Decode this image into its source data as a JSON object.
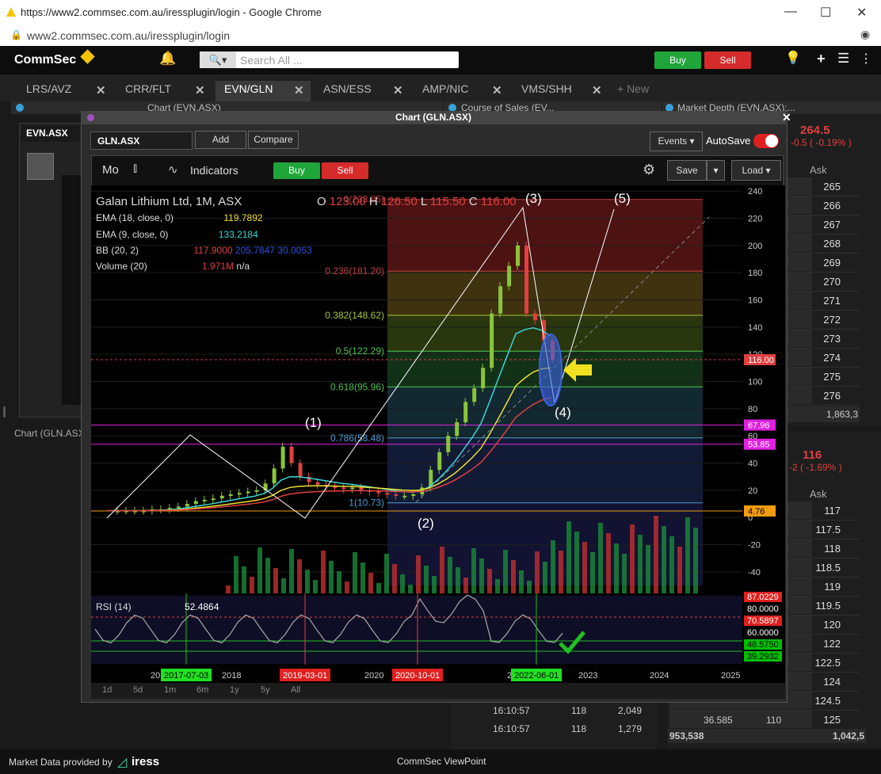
{
  "browser": {
    "title": "https://www2.commsec.com.au/iressplugin/login - Google Chrome",
    "url": "www2.commsec.com.au/iressplugin/login"
  },
  "app": {
    "logo": "CommSec",
    "search_placeholder": "Search All ...",
    "buy_label": "Buy",
    "sell_label": "Sell"
  },
  "tabs": [
    {
      "label": "LRS/AVZ"
    },
    {
      "label": "CRR/FLT"
    },
    {
      "label": "EVN/GLN"
    },
    {
      "label": "ASN/ESS"
    },
    {
      "label": "AMP/NIC"
    },
    {
      "label": "VMS/SHH"
    },
    {
      "label": "+ New"
    }
  ],
  "panels": {
    "chart_evn": "Chart (EVN.ASX)",
    "course_of_sales": "Course of Sales (EV...",
    "market_depth": "Market Depth (EVN.ASX):...",
    "left_symbol": "EVN.ASX",
    "left_footer": "Chart (GLN.ASX)"
  },
  "depth_top": {
    "price": "264.5",
    "change": "-0.5 ( -0.19% )",
    "ask_header": "Ask",
    "asks": [
      "265",
      "266",
      "267",
      "268",
      "269",
      "270",
      "271",
      "272",
      "273",
      "274",
      "275",
      "276"
    ],
    "footer_value": "1,863,3"
  },
  "depth_bottom": {
    "price": "116",
    "change": "-2 ( -1.69% )",
    "ask_header": "Ask",
    "asks": [
      "117",
      "117.5",
      "118",
      "118.5",
      "119",
      "119.5",
      "120",
      "122",
      "122.5",
      "124",
      "124.5",
      "125"
    ],
    "last_row": [
      "36.585",
      "110"
    ],
    "footer_left": "953,538",
    "footer_right": "1,042,5"
  },
  "cos_rows": [
    [
      "16:10:57",
      "118",
      "2,049"
    ],
    [
      "16:10:57",
      "118",
      "1,279"
    ]
  ],
  "modal": {
    "title": "Chart (GLN.ASX)",
    "symbol": "GLN.ASX",
    "add_label": "Add",
    "compare_label": "Compare",
    "events_label": "Events",
    "autosave_label": "AutoSave",
    "period_label": "Mo",
    "indicators_label": "Indicators",
    "buy_label": "Buy",
    "sell_label": "Sell",
    "save_label": "Save",
    "load_label": "Load",
    "timeframes": [
      "1d",
      "5d",
      "1m",
      "6m",
      "1y",
      "5y",
      "All"
    ]
  },
  "legend": {
    "title": "Galan Lithium Ltd, 1M, ASX",
    "ohlc": {
      "o": "123.00",
      "h": "126.50",
      "l": "115.50",
      "c": "116.00"
    },
    "ema18": {
      "label": "EMA (18, close, 0)",
      "value": "119.7892"
    },
    "ema9": {
      "label": "EMA (9, close, 0)",
      "value": "133.2184"
    },
    "bb": {
      "label": "BB (20, 2)",
      "v1": "117.9000",
      "v2": "205.7847",
      "v3": "30.0053"
    },
    "volume": {
      "label": "Volume (20)",
      "v1": "1.971M",
      "v2": "n/a"
    },
    "rsi": {
      "label": "RSI (14)",
      "value": "52.4864"
    }
  },
  "chart_data": {
    "type": "line",
    "title": "Galan Lithium Ltd, 1M, ASX",
    "y_ticks": [
      240,
      220,
      200,
      180,
      160,
      140,
      120,
      100,
      80,
      60,
      40,
      20,
      0,
      -20,
      -40
    ],
    "ylim": [
      -50,
      250
    ],
    "x_ticks": [
      "2017",
      "2018",
      "2019",
      "2020",
      "2021",
      "2022",
      "2023",
      "2024",
      "2025"
    ],
    "date_flags": [
      "2017-07-03",
      "2019-03-01",
      "2020-10-01",
      "2022-06-01"
    ],
    "fib_levels": [
      {
        "label": "0(233.85)",
        "value": 233.85,
        "color": "#c04040"
      },
      {
        "label": "0.236(181.20)",
        "value": 181.2,
        "color": "#c04040"
      },
      {
        "label": "0.382(148.62)",
        "value": 148.62,
        "color": "#a6c43a"
      },
      {
        "label": "0.5(122.29)",
        "value": 122.29,
        "color": "#4fc44f"
      },
      {
        "label": "0.618(95.96)",
        "value": 95.96,
        "color": "#4fc44f"
      },
      {
        "label": "0.786(58.48)",
        "value": 58.48,
        "color": "#4a9ad4"
      },
      {
        "label": "1(10.73)",
        "value": 10.73,
        "color": "#4a9ad4"
      }
    ],
    "price_tags": [
      {
        "label": "116.00",
        "value": 116.0,
        "color": "#e04040"
      },
      {
        "label": "67.96",
        "value": 67.96,
        "color": "#e020e0"
      },
      {
        "label": "53.85",
        "value": 53.85,
        "color": "#e020e0"
      },
      {
        "label": "4.76",
        "value": 4.76,
        "color": "#f39c12"
      }
    ],
    "wave_labels": [
      "(1)",
      "(2)",
      "(3)",
      "(4)",
      "(5)"
    ],
    "rsi_tags": [
      {
        "label": "87.0229",
        "color": "#e02020"
      },
      {
        "label": "80.0000",
        "color": "#000000"
      },
      {
        "label": "70.5897",
        "color": "#e02020"
      },
      {
        "label": "60.0000",
        "color": "#000000"
      },
      {
        "label": "48.5750",
        "color": "#00c000"
      },
      {
        "label": "39.2932",
        "color": "#00c000"
      }
    ],
    "series": [
      {
        "values": [
          5,
          5,
          5,
          5,
          5,
          6,
          6,
          7,
          8,
          10,
          12,
          13,
          14,
          16,
          17,
          18,
          19,
          20,
          25,
          36,
          52,
          40,
          30,
          26,
          24,
          23,
          22,
          21,
          22,
          20,
          19,
          18,
          17,
          16,
          16,
          17,
          22,
          35,
          48,
          60,
          70,
          85,
          95,
          110,
          150,
          170,
          185,
          200,
          150,
          145,
          130,
          116
        ]
      }
    ]
  },
  "status": {
    "left": "Market Data provided by",
    "brand": "iress",
    "center": "CommSec ViewPoint"
  }
}
